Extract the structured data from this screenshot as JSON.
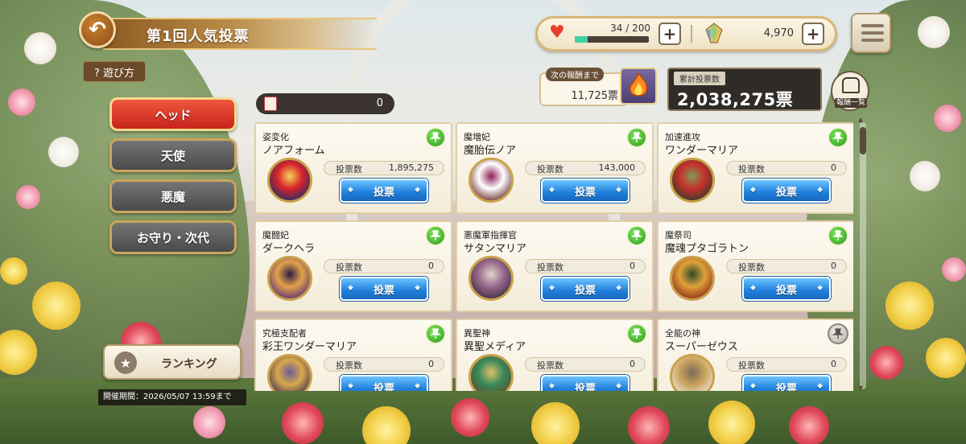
{
  "header": {
    "title": "第1回人気投票",
    "howto_label": "? 遊び方",
    "back_icon": "back-arrow-icon"
  },
  "resources": {
    "stamina_text": "34 / 200",
    "stamina_fraction": 0.17,
    "crystal_count": "4,970"
  },
  "reward": {
    "next_label": "次の報酬まで",
    "next_value": "11,725票",
    "total_label": "累計投票数",
    "total_value": "2,038,275票",
    "list_label": "報酬一覧"
  },
  "ticket": {
    "icon_text": "投票券",
    "count": "0"
  },
  "tabs": [
    {
      "label": "ヘッド",
      "active": true
    },
    {
      "label": "天使",
      "active": false
    },
    {
      "label": "悪魔",
      "active": false
    },
    {
      "label": "お守り・次代",
      "active": false
    }
  ],
  "ranking_label": "ランキング",
  "period": "開催期間：2026/05/07 13:59まで",
  "vote_count_label": "投票数",
  "vote_button_label": "投票",
  "cards": [
    {
      "sub": "姿変化",
      "name": "ノアフォーム",
      "votes": "1,895,275",
      "pin": "green",
      "colors": [
        "#1c2e6a",
        "#d8242b",
        "#f5d35a"
      ]
    },
    {
      "sub": "魔増妃",
      "name": "魔胎伝ノア",
      "votes": "143,000",
      "pin": "green",
      "colors": [
        "#6a2c2c",
        "#ffffff",
        "#8b1f55"
      ]
    },
    {
      "sub": "加速進攻",
      "name": "ワンダーマリア",
      "votes": "0",
      "pin": "green",
      "colors": [
        "#2c3d2a",
        "#c8302c",
        "#7e9b5a"
      ]
    },
    {
      "sub": "魔闘妃",
      "name": "ダークヘラ",
      "votes": "0",
      "pin": "green",
      "colors": [
        "#5a2c7a",
        "#e3a24a",
        "#2f1b45"
      ]
    },
    {
      "sub": "悪魔軍指揮官",
      "name": "サタンマリア",
      "votes": "0",
      "pin": "green",
      "colors": [
        "#3b2c3e",
        "#9a6a8e",
        "#e0d6c8"
      ]
    },
    {
      "sub": "魔祭司",
      "name": "魔魂プタゴラトン",
      "votes": "0",
      "pin": "green",
      "colors": [
        "#8a2a1a",
        "#e0a23a",
        "#2c4a2a"
      ]
    },
    {
      "sub": "究極支配者",
      "name": "彩王ワンダーマリア",
      "votes": "0",
      "pin": "green",
      "colors": [
        "#3a2a5a",
        "#d8a84a",
        "#6a5a9a"
      ]
    },
    {
      "sub": "異聖神",
      "name": "異聖メディア",
      "votes": "0",
      "pin": "green",
      "colors": [
        "#5a4a2a",
        "#3a8a5a",
        "#e0c26a"
      ]
    },
    {
      "sub": "全能の神",
      "name": "スーパーゼウス",
      "votes": "0",
      "pin": "grey",
      "colors": [
        "#f0e8d8",
        "#c8a05a",
        "#7a6a5a"
      ]
    }
  ]
}
